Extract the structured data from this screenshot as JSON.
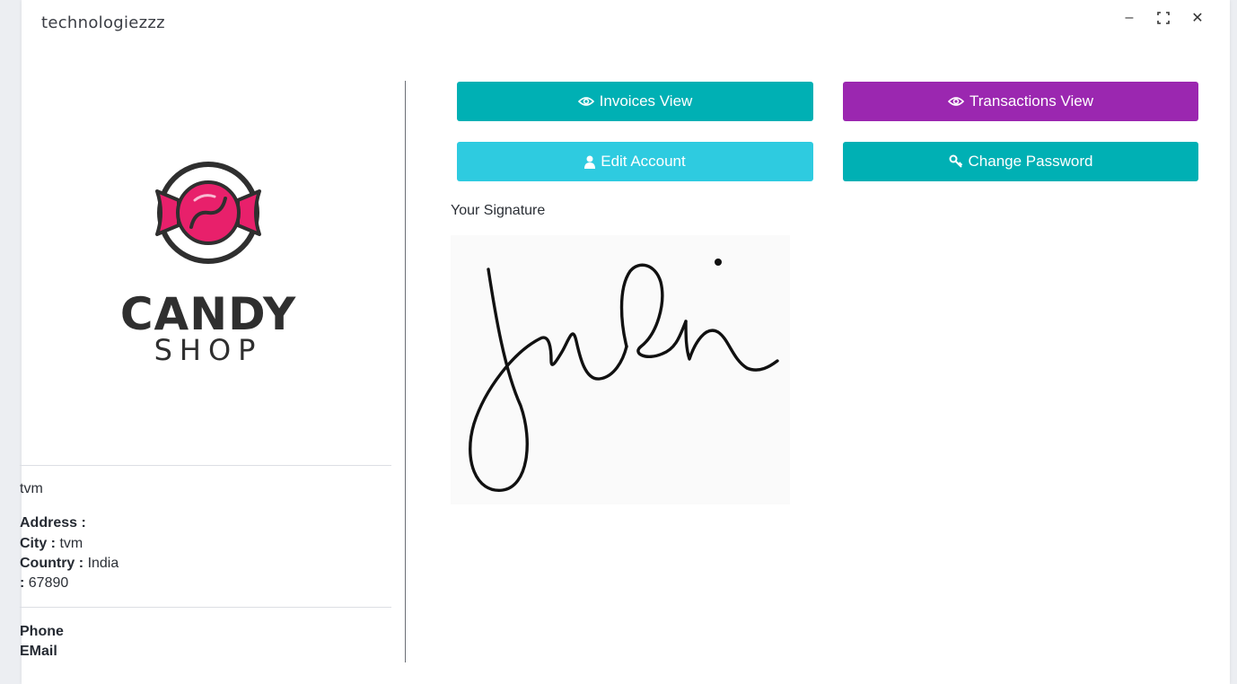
{
  "window": {
    "title": "technologiezzz",
    "controls": {
      "minimize": "–",
      "maximize": "⛶",
      "close": "✕"
    }
  },
  "logo": {
    "line1": "CANDY",
    "line2": "SHOP",
    "colors": {
      "candy": "#e8206b",
      "wrapper": "#e8206b",
      "text": "#2f2f2f"
    }
  },
  "profile": {
    "name": "tvm",
    "address_label": "Address :",
    "address_value": "",
    "city_label": "City :",
    "city_value": "tvm",
    "country_label": "Country :",
    "country_value": "India",
    "pin_label": ":",
    "pin_value": "67890",
    "phone_label": "Phone",
    "email_label": "EMail"
  },
  "actions": {
    "invoices": {
      "label": "Invoices View",
      "icon": "eye-icon",
      "color": "#00b0b4"
    },
    "transactions": {
      "label": "Transactions View",
      "icon": "eye-icon",
      "color": "#9b27b0"
    },
    "edit_account": {
      "label": "Edit Account",
      "icon": "user-icon",
      "color": "#2ecbe0"
    },
    "change_password": {
      "label": "Change Password",
      "icon": "key-icon",
      "color": "#00b0b4"
    }
  },
  "signature": {
    "label": "Your Signature"
  }
}
